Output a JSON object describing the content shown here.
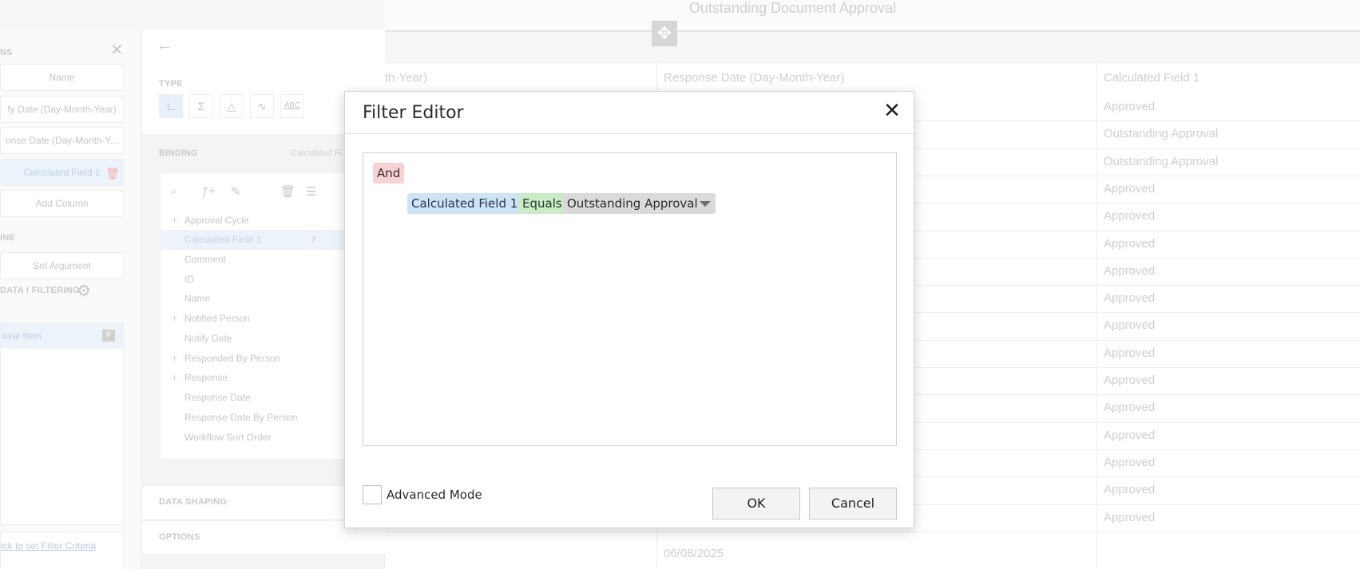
{
  "background": {
    "title": "Outstanding Document Approval",
    "left_panel": {
      "section_columns": "NS",
      "columns": [
        "Name",
        "fy Date (Day-Month-Year)",
        "onse Date (Day-Month-Y...",
        "Calculated Field 1",
        "Add Column"
      ],
      "section_line": "INE",
      "set_argument": "Set Argument",
      "section_data": "DATA / FILTERING",
      "filter_item": "oval Item",
      "filter_badge": "F",
      "link": "ick to set Filter Criteria"
    },
    "middle_panel": {
      "type_label": "TYPE",
      "type_icons": [
        "axis-icon",
        "sigma-icon",
        "triangle-icon",
        "trend-icon",
        "abc-icon"
      ],
      "type_glyphs": [
        "∟",
        "Σ",
        "△",
        "∿",
        "ABC"
      ],
      "binding_label": "BINDING",
      "binding_value": "Calculated Fi",
      "fields": [
        {
          "label": "Approval Cycle",
          "expand": true
        },
        {
          "label": "Calculated Field 1",
          "expand": false,
          "selected": true,
          "fx": "f"
        },
        {
          "label": "Comment",
          "expand": false
        },
        {
          "label": "ID",
          "expand": false
        },
        {
          "label": "Name",
          "expand": false
        },
        {
          "label": "Notified Person",
          "expand": true
        },
        {
          "label": "Notify Date",
          "expand": false
        },
        {
          "label": "Responded By Person",
          "expand": true
        },
        {
          "label": "Response",
          "expand": true
        },
        {
          "label": "Response Date",
          "expand": false
        },
        {
          "label": "Response Date By Person",
          "expand": false
        },
        {
          "label": "Workflow Sort Order",
          "expand": false
        }
      ],
      "section_data_shaping": "DATA SHAPING",
      "section_options": "OPTIONS"
    },
    "grid": {
      "headers": [
        "th-Year)",
        "Response Date (Day-Month-Year)",
        "Calculated Field 1"
      ],
      "calculated": [
        "Approved",
        "Outstanding Approval",
        "Outstanding Approval",
        "Approved",
        "Approved",
        "Approved",
        "Approved",
        "Approved",
        "Approved",
        "Approved",
        "Approved",
        "Approved",
        "Approved",
        "Approved",
        "Approved",
        "Approved"
      ],
      "last_response_date": "06/08/2025"
    }
  },
  "modal": {
    "title": "Filter Editor",
    "close": "✕",
    "group_operator": "And",
    "condition": {
      "field": "Calculated Field 1",
      "operator": "Equals",
      "value": "Outstanding Approval"
    },
    "advanced_mode_label": "Advanced Mode",
    "advanced_mode_checked": false,
    "ok_label": "OK",
    "cancel_label": "Cancel"
  }
}
